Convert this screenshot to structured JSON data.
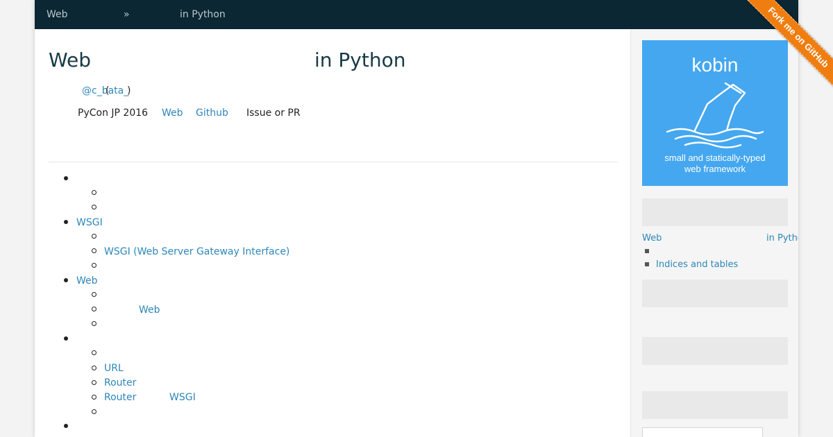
{
  "breadcrumb": {
    "home": "Web",
    "separator": "»",
    "current": "in Python"
  },
  "header": {
    "title_left": "Web",
    "title_right": "in Python"
  },
  "meta": {
    "author_handle": "@c_bata_",
    "paren_open": "(",
    "paren_close": ")",
    "event": "PyCon JP 2016",
    "link_web": "Web",
    "link_github": "Github",
    "issue": "Issue or PR"
  },
  "toc": {
    "sec1": {},
    "sec2": {
      "label": "WSGI",
      "child2": "WSGI (Web Server Gateway Interface)"
    },
    "sec3": {
      "label": "Web",
      "child2": "Web"
    },
    "sec4": {
      "child2": "URL",
      "child3": "Router",
      "child4_a": "Router",
      "child4_b": "WSGI"
    }
  },
  "sidebar": {
    "logo_name": "kobin",
    "logo_tagline_1": "small and statically-typed",
    "logo_tagline_2": "web framework",
    "toc_title_left": "Web",
    "toc_title_right": "in Python",
    "toc_item": "Indices and tables"
  },
  "ribbon": {
    "label": "Fork me on GitHub"
  },
  "colors": {
    "topbar": "#0b2733",
    "link": "#2d86b8",
    "logo_bg": "#45a7ef",
    "ribbon": "#ef7d10"
  }
}
